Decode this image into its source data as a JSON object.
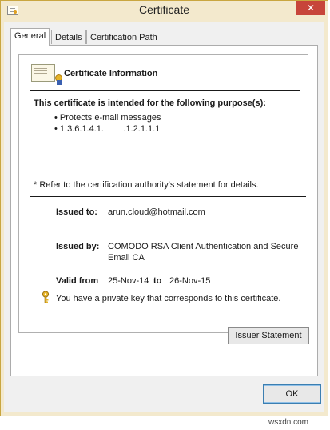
{
  "window": {
    "title": "Certificate",
    "close_glyph": "✕"
  },
  "tabs": [
    {
      "label": "General",
      "active": true
    },
    {
      "label": "Details",
      "active": false
    },
    {
      "label": "Certification Path",
      "active": false
    }
  ],
  "general": {
    "heading": "Certificate Information",
    "purpose_heading": "This certificate is intended for the following purpose(s):",
    "purposes": [
      "Protects e-mail messages",
      "1.3.6.1.4.1.        .1.2.1.1.1"
    ],
    "footnote": "Refer to the certification authority's statement for details.",
    "issued_to_label": "Issued to:",
    "issued_to_value": "arun.cloud@hotmail.com",
    "issued_by_label": "Issued by:",
    "issued_by_value_line1": "COMODO RSA Client Authentication and Secure",
    "issued_by_value_line2": "Email CA",
    "valid_from_label": "Valid from",
    "valid_from_value": "25-Nov-14",
    "valid_to_label": "to",
    "valid_to_value": "26-Nov-15",
    "private_key_note": "You have a private key that corresponds to this certificate."
  },
  "buttons": {
    "issuer_statement": "Issuer Statement",
    "ok": "OK"
  },
  "watermark": "wsxdn.com"
}
